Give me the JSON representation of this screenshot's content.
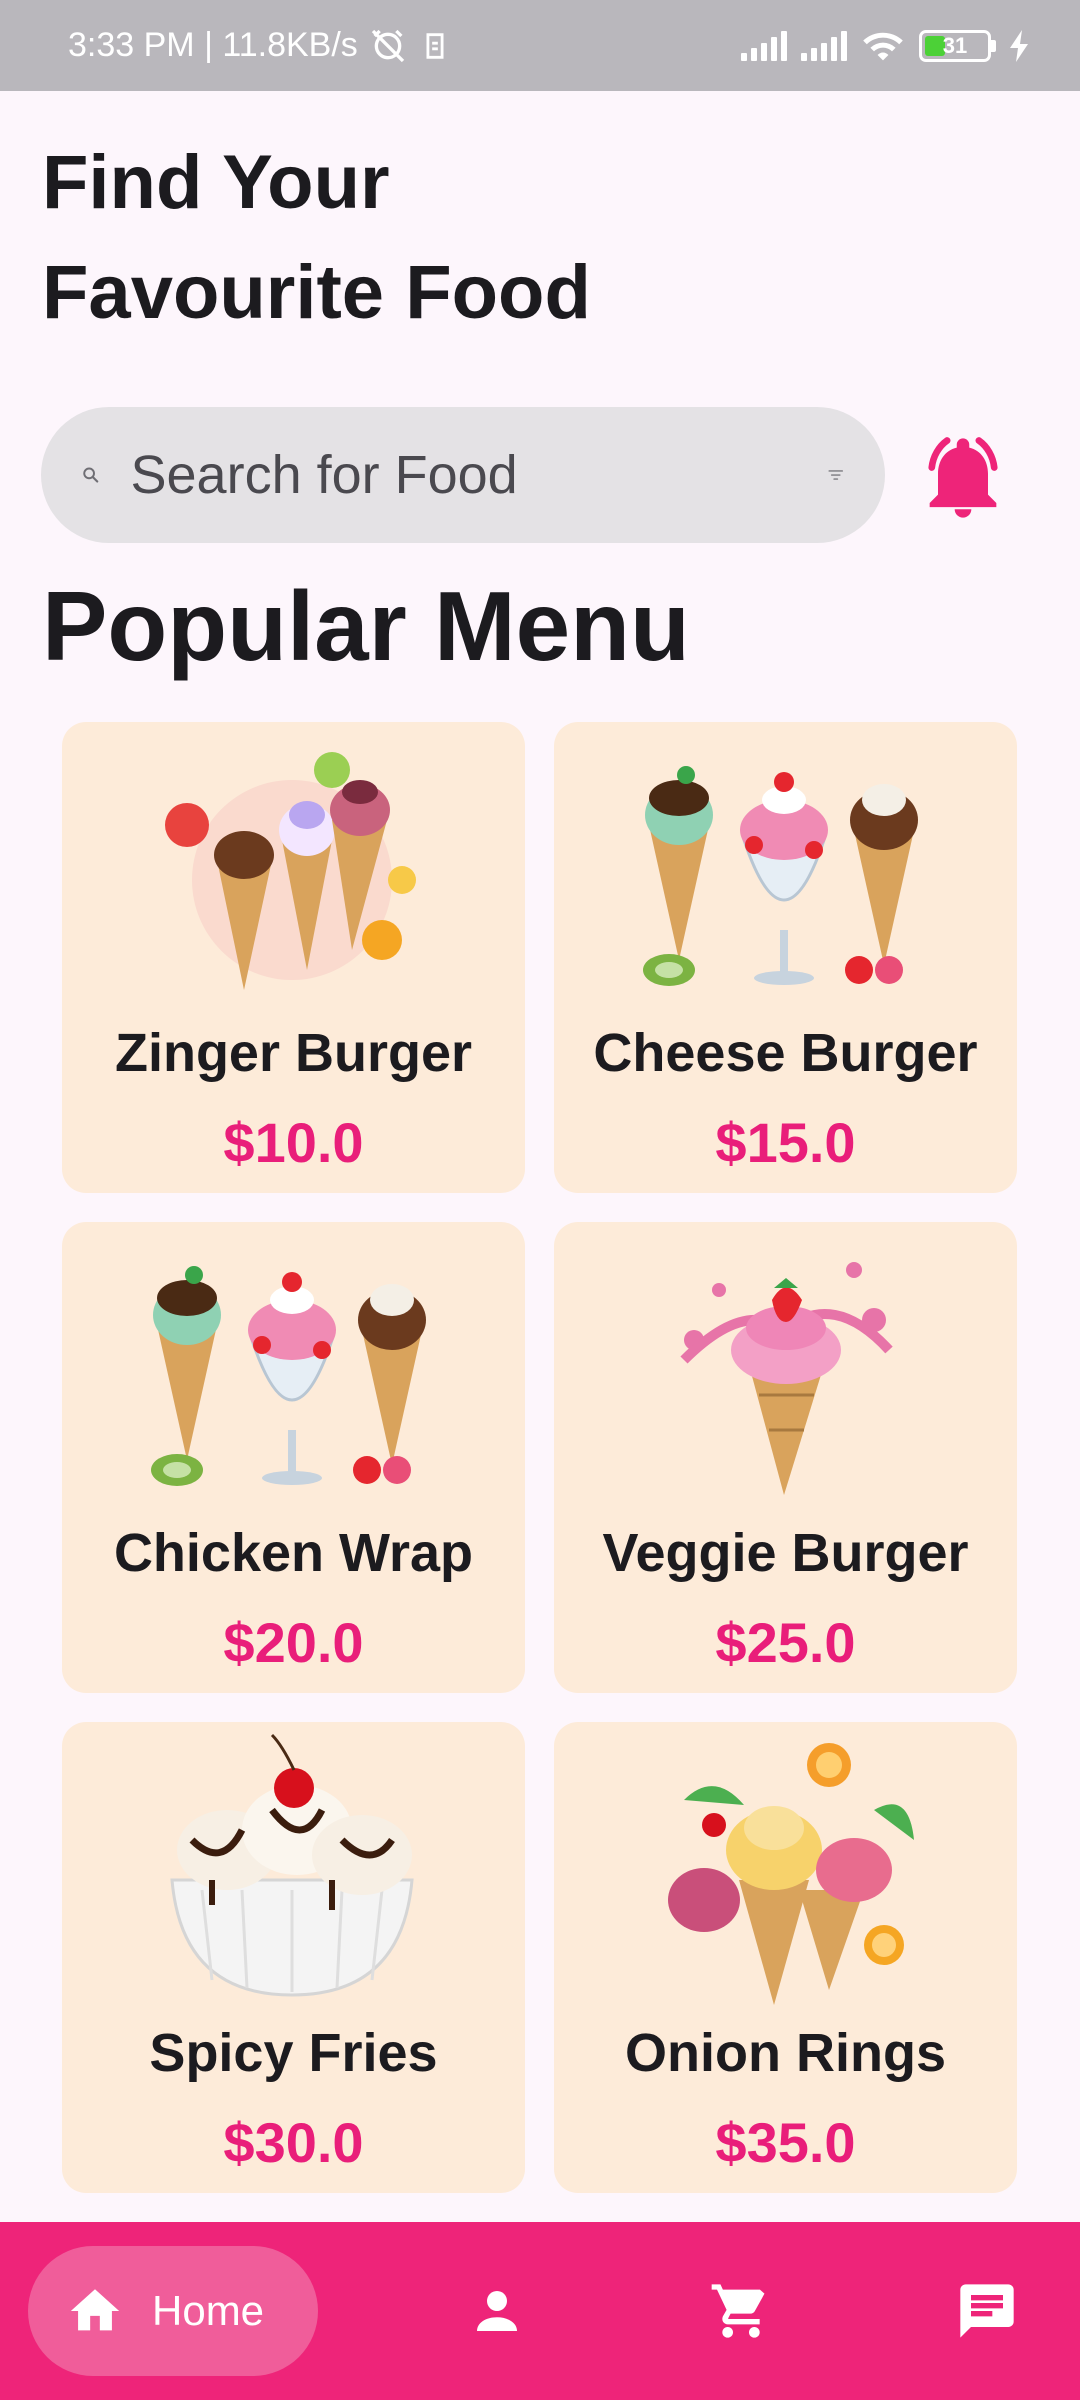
{
  "status_bar": {
    "time_speed": "3:33 PM | 11.8KB/s",
    "battery_level": "31",
    "icons": [
      "alarm-off-icon",
      "data-saver-icon",
      "signal-icon",
      "signal-icon",
      "wifi-icon",
      "battery-icon",
      "charging-icon"
    ]
  },
  "header": {
    "title_line1": "Find Your",
    "title_line2": "Favourite Food"
  },
  "search": {
    "placeholder": "Search for Food",
    "value": ""
  },
  "section": {
    "title": "Popular Menu"
  },
  "menu_items": [
    {
      "name": "Zinger Burger",
      "price": "$10.0",
      "image": "ice-cream-splash-image"
    },
    {
      "name": "Cheese Burger",
      "price": "$15.0",
      "image": "ice-cream-trio-image"
    },
    {
      "name": "Chicken Wrap",
      "price": "$20.0",
      "image": "ice-cream-trio-image"
    },
    {
      "name": "Veggie Burger",
      "price": "$25.0",
      "image": "strawberry-cone-image"
    },
    {
      "name": "Spicy Fries",
      "price": "$30.0",
      "image": "sundae-bowl-image"
    },
    {
      "name": "Onion Rings",
      "price": "$35.0",
      "image": "fruit-cones-image"
    }
  ],
  "bottom_nav": {
    "home_label": "Home",
    "items": [
      "home-icon",
      "person-icon",
      "cart-icon",
      "chat-icon"
    ]
  },
  "colors": {
    "accent": "#ee2479",
    "price": "#e91e7a",
    "card_bg": "#fdebd9",
    "page_bg": "#fdf6fc",
    "search_bg": "#e4e2e5"
  }
}
